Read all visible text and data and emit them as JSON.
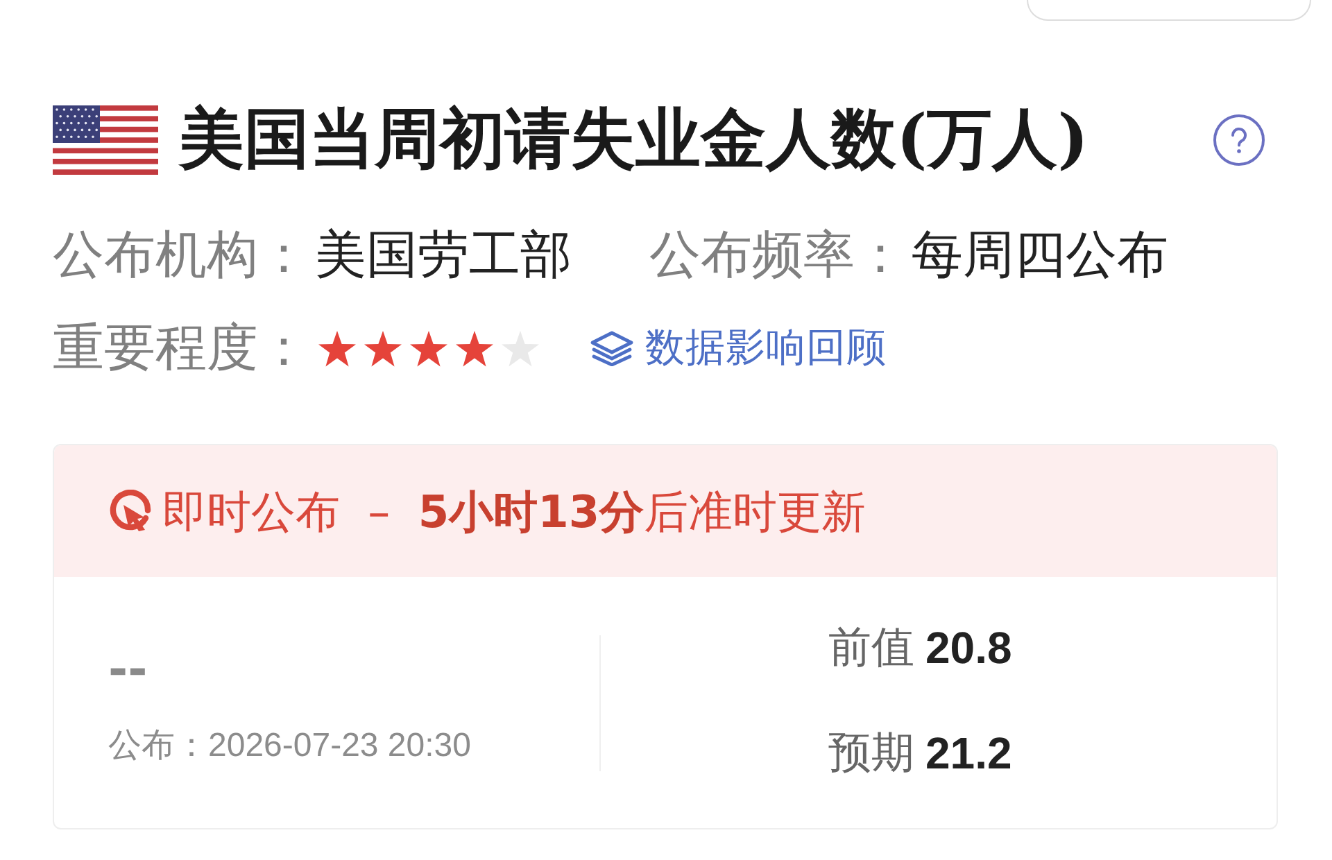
{
  "header": {
    "title": "美国当周初请失业金人数(万人)"
  },
  "meta": [
    {
      "label": "公布机构：",
      "value": "美国劳工部"
    },
    {
      "label": "公布频率：",
      "value": "每周四公布"
    }
  ],
  "importance": {
    "label": "重要程度：",
    "stars": 4,
    "link": "数据影响回顾"
  },
  "release": {
    "status": "即时公布 – **5小时13分**后准时更新",
    "actual": "--",
    "time": "公布：2026-07-23 20:30",
    "stats": [
      {
        "label": "前值",
        "value": "20.8"
      },
      {
        "label": "预期",
        "value": "21.2"
      }
    ]
  }
}
